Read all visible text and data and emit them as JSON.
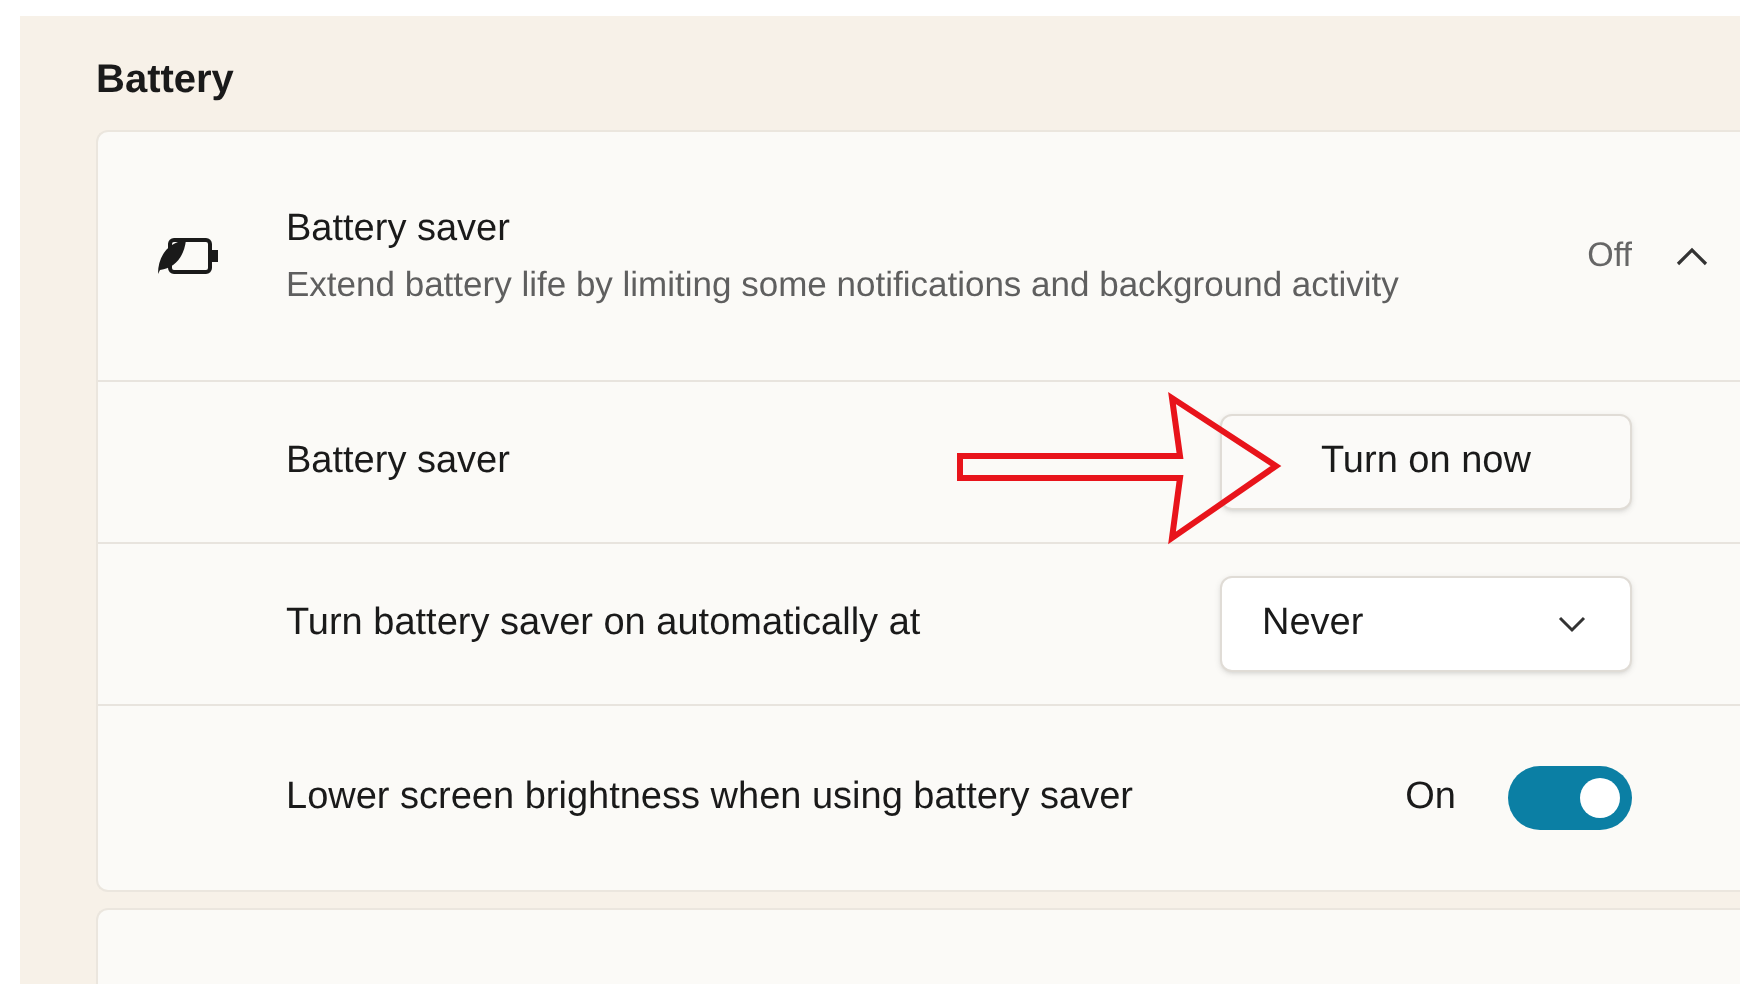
{
  "section_title": "Battery",
  "header": {
    "title": "Battery saver",
    "description": "Extend battery life by limiting some notifications and background activity",
    "status": "Off",
    "expanded": true
  },
  "rows": [
    {
      "kind": "button",
      "label": "Battery saver",
      "button": "Turn on now"
    },
    {
      "kind": "dropdown",
      "label": "Turn battery saver on automatically at",
      "value": "Never"
    },
    {
      "kind": "toggle",
      "label": "Lower screen brightness when using battery saver",
      "status": "On",
      "on": true
    }
  ]
}
